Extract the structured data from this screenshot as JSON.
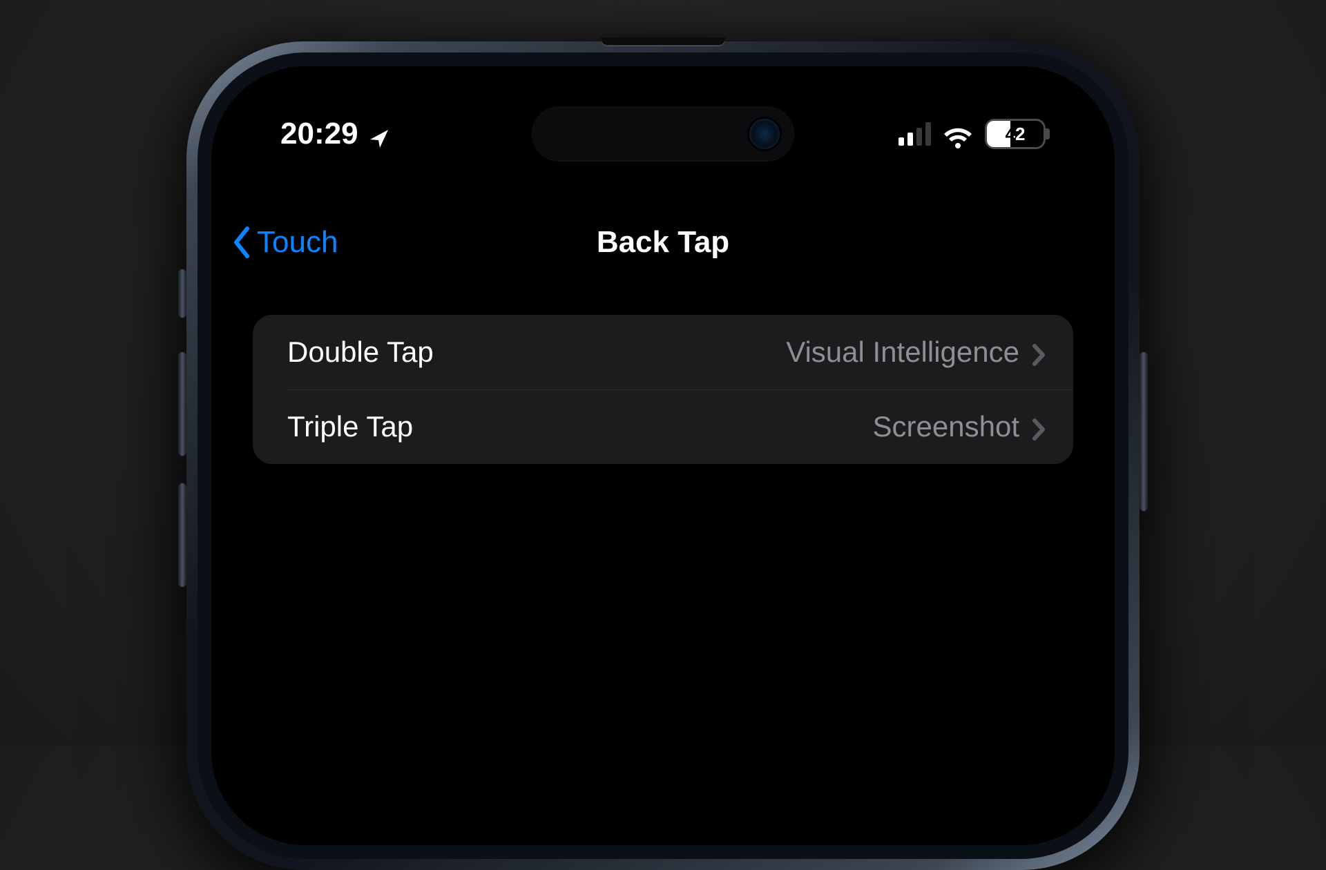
{
  "status": {
    "time": "20:29",
    "battery_percent": "42"
  },
  "nav": {
    "back_label": "Touch",
    "title": "Back Tap"
  },
  "rows": [
    {
      "label": "Double Tap",
      "value": "Visual Intelligence"
    },
    {
      "label": "Triple Tap",
      "value": "Screenshot"
    }
  ]
}
